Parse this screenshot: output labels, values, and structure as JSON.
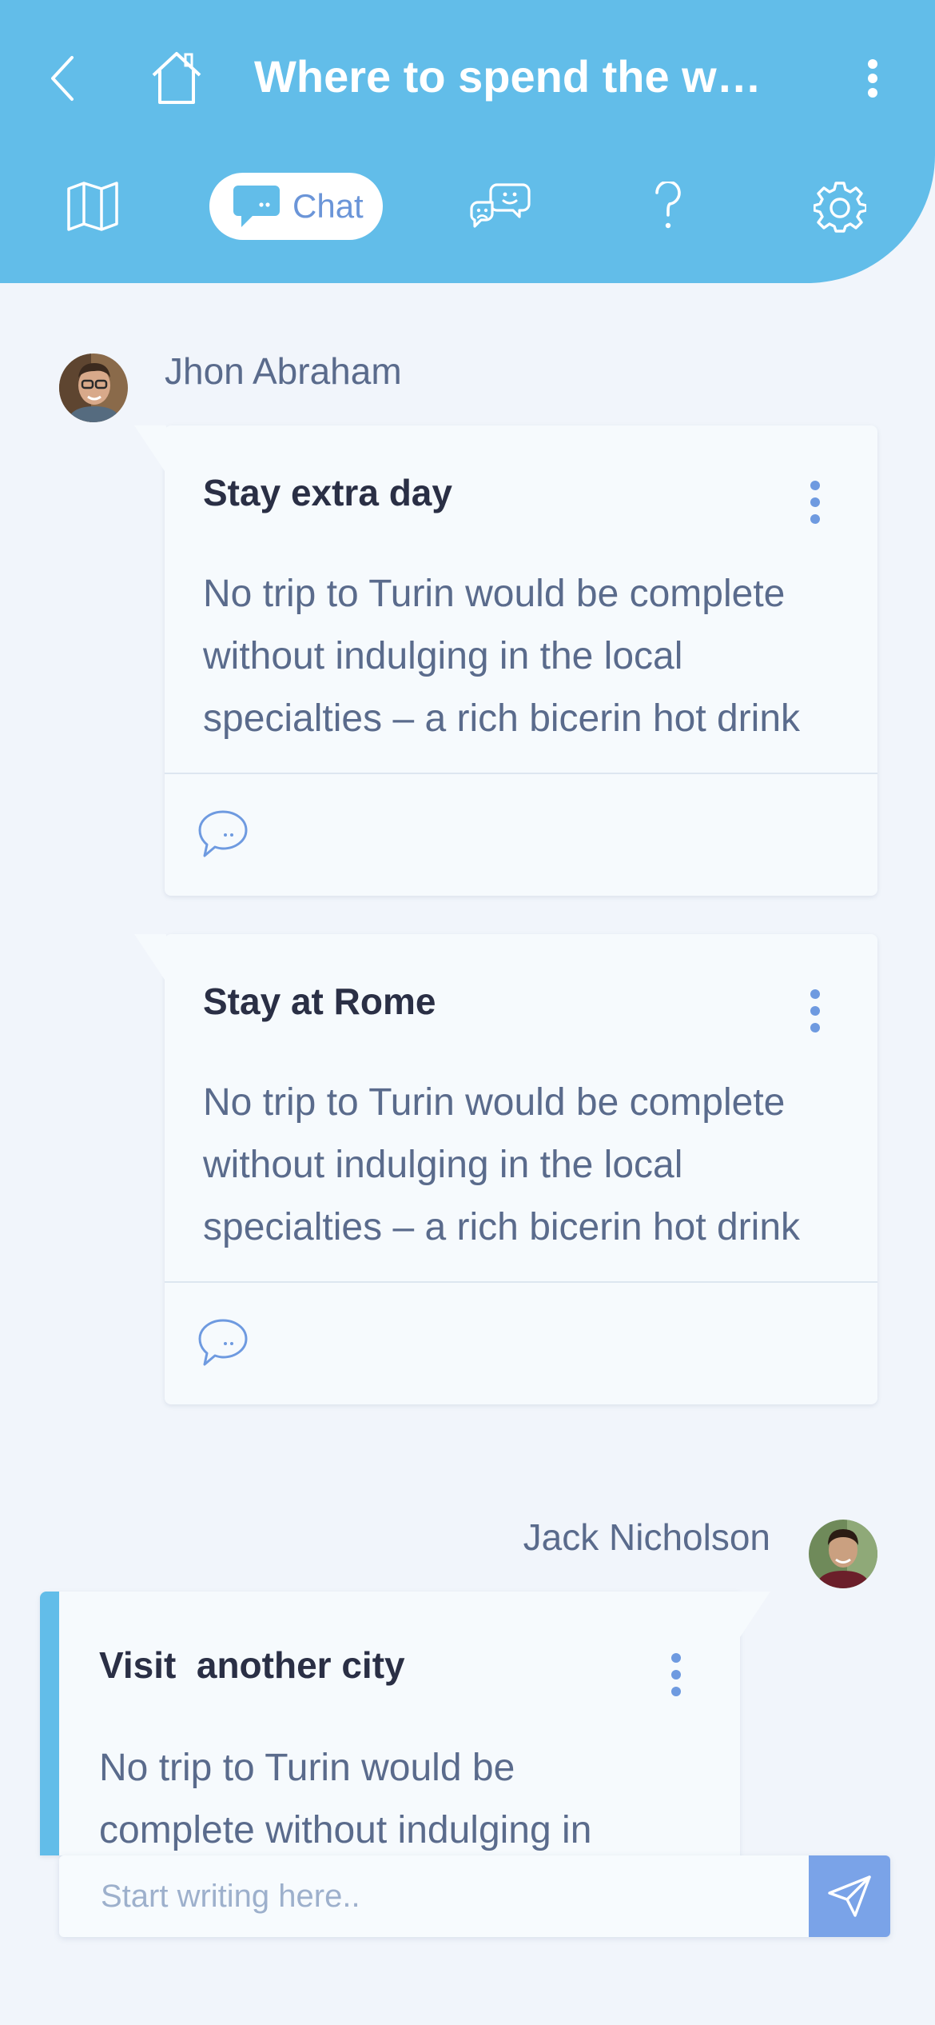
{
  "header": {
    "title": "Where to spend the weekend",
    "tabs": [
      {
        "id": "map",
        "icon": "map-icon"
      },
      {
        "id": "chat",
        "icon": "chat-bubble-icon",
        "label": "Chat",
        "active": true
      },
      {
        "id": "feedback",
        "icon": "feedback-faces-icon"
      },
      {
        "id": "help",
        "icon": "question-icon"
      },
      {
        "id": "settings",
        "icon": "gear-icon"
      }
    ],
    "colors": {
      "background": "#62bde9",
      "active_tab_text": "#6b95d8"
    }
  },
  "messages": [
    {
      "sender": "Jhon Abraham",
      "side": "left",
      "cards": [
        {
          "title": "Stay extra day",
          "body_lines": [
            "No trip to Turin would be complete",
            "without indulging in the local",
            "specialties – a rich bicerin hot drink"
          ]
        },
        {
          "title": "Stay at Rome",
          "body_lines": [
            "No trip to Turin would be complete",
            "without indulging in the local",
            "specialties – a rich bicerin hot drink"
          ]
        }
      ]
    },
    {
      "sender": "Jack Nicholson",
      "side": "right",
      "cards": [
        {
          "title": "Visit  another city",
          "body_lines": [
            "No trip to Turin would be",
            "complete without indulging in"
          ]
        }
      ]
    }
  ],
  "composer": {
    "placeholder": "Start writing here..",
    "value": ""
  },
  "accent_colors": {
    "own_message_bar": "#62bde9",
    "send_button": "#7aa3e8",
    "menu_dots": "#6e9ae0"
  }
}
